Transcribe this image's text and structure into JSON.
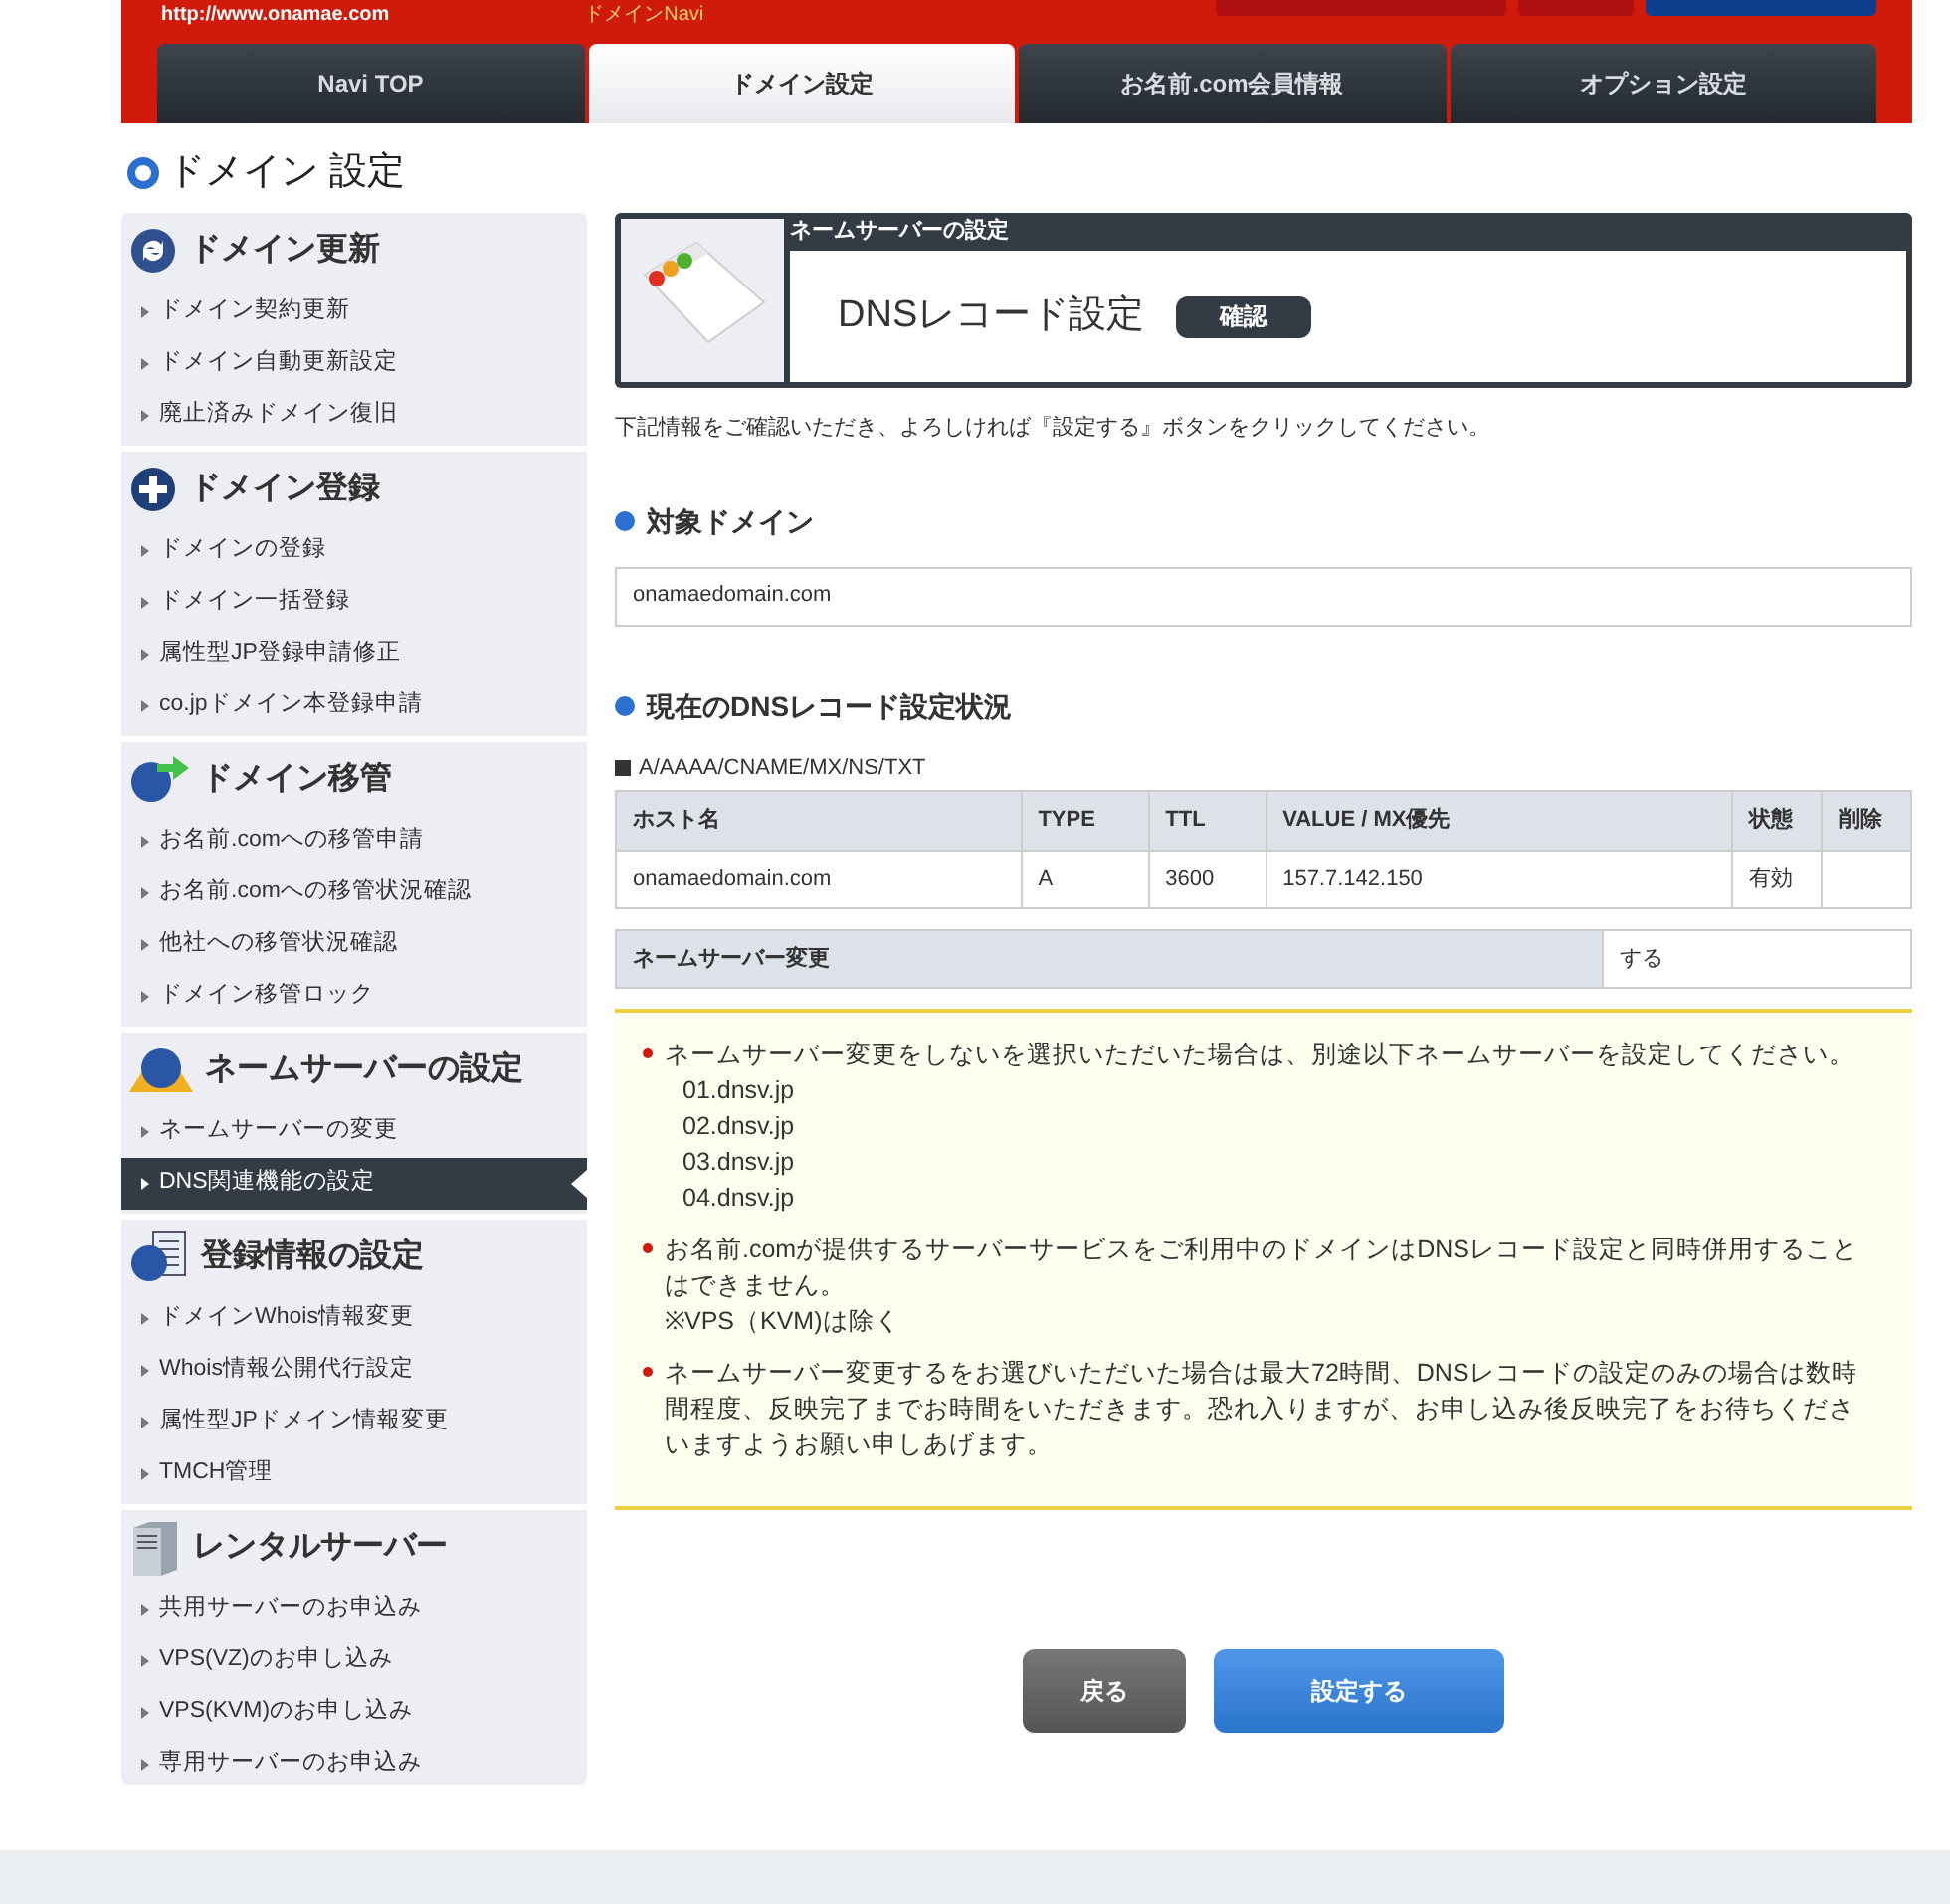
{
  "header": {
    "site_url": "http://www.onamae.com",
    "app_name": "ドメインNavi",
    "buttons": [
      {
        "color": "#b01010"
      },
      {
        "color": "#b01010"
      },
      {
        "color": "#0d3e8c"
      }
    ]
  },
  "tabs": [
    {
      "label": "Navi TOP",
      "selected": false
    },
    {
      "label": "ドメイン設定",
      "selected": true
    },
    {
      "label": "お名前.com会員情報",
      "selected": false
    },
    {
      "label": "オプション設定",
      "selected": false
    }
  ],
  "page_title": "ドメイン 設定",
  "sidebar": {
    "sections": [
      {
        "title": "ドメイン更新",
        "items": [
          {
            "label": "ドメイン契約更新",
            "selected": false
          },
          {
            "label": "ドメイン自動更新設定",
            "selected": false
          },
          {
            "label": "廃止済みドメイン復旧",
            "selected": false
          }
        ]
      },
      {
        "title": "ドメイン登録",
        "items": [
          {
            "label": "ドメインの登録",
            "selected": false
          },
          {
            "label": "ドメイン一括登録",
            "selected": false
          },
          {
            "label": "属性型JP登録申請修正",
            "selected": false
          },
          {
            "label": "co.jpドメイン本登録申請",
            "selected": false
          }
        ]
      },
      {
        "title": "ドメイン移管",
        "items": [
          {
            "label": "お名前.comへの移管申請",
            "selected": false
          },
          {
            "label": "お名前.comへの移管状況確認",
            "selected": false
          },
          {
            "label": "他社への移管状況確認",
            "selected": false
          },
          {
            "label": "ドメイン移管ロック",
            "selected": false
          }
        ]
      },
      {
        "title": "ネームサーバーの設定",
        "items": [
          {
            "label": "ネームサーバーの変更",
            "selected": false
          },
          {
            "label": "DNS関連機能の設定",
            "selected": true
          }
        ]
      },
      {
        "title": "登録情報の設定",
        "items": [
          {
            "label": "ドメインWhois情報変更",
            "selected": false
          },
          {
            "label": "Whois情報公開代行設定",
            "selected": false
          },
          {
            "label": "属性型JPドメイン情報変更",
            "selected": false
          },
          {
            "label": "TMCH管理",
            "selected": false
          }
        ]
      },
      {
        "title": "レンタルサーバー",
        "items": [
          {
            "label": "共用サーバーのお申込み",
            "selected": false
          },
          {
            "label": "VPS(VZ)のお申し込み",
            "selected": false
          },
          {
            "label": "VPS(KVM)のお申し込み",
            "selected": false
          },
          {
            "label": "専用サーバーのお申込み",
            "selected": false
          }
        ]
      }
    ]
  },
  "panel": {
    "caption": "ネームサーバーの設定",
    "title": "DNSレコード設定",
    "badge": "確認"
  },
  "intro": "下記情報をご確認いただき、よろしければ『設定する』ボタンをクリックしてください。",
  "target_domain": {
    "heading": "対象ドメイン",
    "value": "onamaedomain.com"
  },
  "records": {
    "heading": "現在のDNSレコード設定状況",
    "types_label": "A/AAAA/CNAME/MX/NS/TXT",
    "columns": [
      "ホスト名",
      "TYPE",
      "TTL",
      "VALUE / MX優先",
      "状態",
      "削除"
    ],
    "rows": [
      [
        "onamaedomain.com",
        "A",
        "3600",
        "157.7.142.150",
        "有効",
        ""
      ]
    ]
  },
  "nameserver_change": {
    "label": "ネームサーバー変更",
    "value": "する"
  },
  "notes": [
    {
      "text": "ネームサーバー変更をしないを選択いただいた場合は、別途以下ネームサーバーを設定してください。",
      "sub_lines": [
        "01.dnsv.jp",
        "02.dnsv.jp",
        "03.dnsv.jp",
        "04.dnsv.jp"
      ]
    },
    {
      "text": "お名前.comが提供するサーバーサービスをご利用中のドメインはDNSレコード設定と同時併用することはできません。",
      "sub_lines": [
        "※VPS（KVM)は除く"
      ]
    },
    {
      "text": "ネームサーバー変更するをお選びいただいた場合は最大72時間、DNSレコードの設定のみの場合は数時間程度、反映完了までお時間をいただきます。恐れ入りますが、お申し込み後反映完了をお待ちくださいますようお願い申しあげます。"
    }
  ],
  "buttons": [
    {
      "label": "戻る",
      "kind": "back"
    },
    {
      "label": "設定する",
      "kind": "primary"
    }
  ]
}
